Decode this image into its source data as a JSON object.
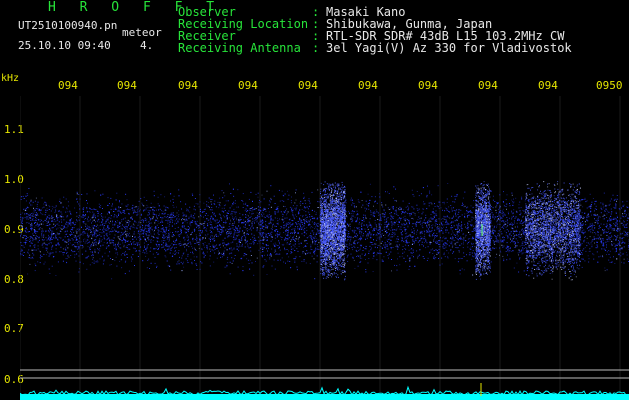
{
  "header": {
    "title": "H R O F F T",
    "filename": "UT2510100940.pn",
    "timestamp": "25.10.10 09:40",
    "meteor_label": "meteor",
    "meteor_value": "4.",
    "fields": [
      {
        "label": "Observer",
        "value": "Masaki Kano"
      },
      {
        "label": "Receiving Location",
        "value": "Shibukawa, Gunma, Japan"
      },
      {
        "label": "Receiver",
        "value": "RTL-SDR SDR# 43dB L15 103.2MHz CW"
      },
      {
        "label": "Receiving Antenna",
        "value": "3el Yagi(V) Az 330 for Vladivostok"
      }
    ]
  },
  "axis": {
    "unit": "kHz",
    "y_ticks": [
      "1.1",
      "1.0",
      "0.9",
      "0.8",
      "0.7",
      "0.6"
    ],
    "x_ticks": [
      "094",
      "094",
      "094",
      "094",
      "094",
      "094",
      "094",
      "094",
      "094",
      "0950"
    ]
  },
  "colors": {
    "background": "#000000",
    "label": "#27e43a",
    "value": "#e8e8e8",
    "tick": "#e6e600",
    "signal": "#2a3cff",
    "strip": "#00ffff"
  }
}
